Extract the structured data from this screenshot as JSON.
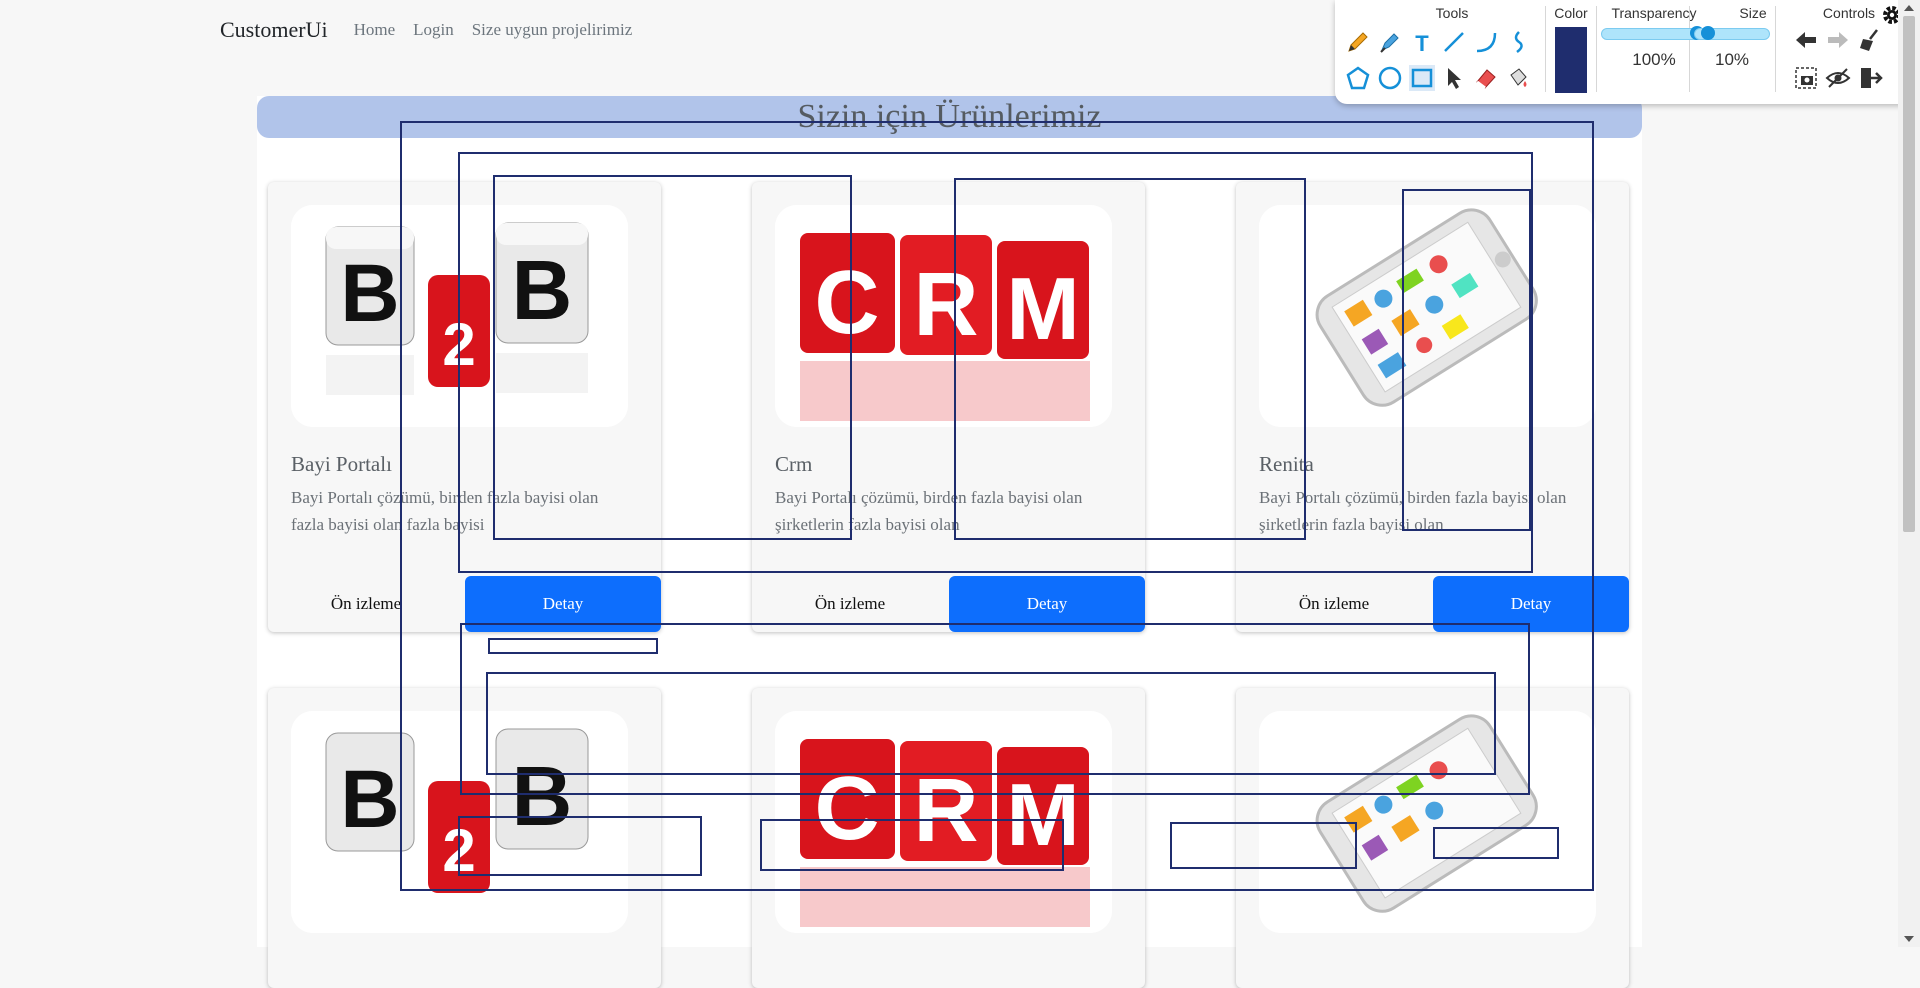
{
  "nav": {
    "brand": "CustomerUi",
    "links": [
      "Home",
      "Login",
      "Size uygun projelirimiz"
    ]
  },
  "page_title": "Sizin için Ürünlerimiz",
  "cards": [
    {
      "image": "b2b-dice-image",
      "title": "Bayi Portalı",
      "text": "Bayi Portalı çözümü, birden fazla bayisi olan fazla bayisi olan fazla bayisi",
      "preview": "Ön izleme",
      "detail": "Detay"
    },
    {
      "image": "crm-cubes-image",
      "title": "Crm",
      "text": "Bayi Portalı çözümü, birden fazla bayisi olan şirketlerin fazla bayisi olan",
      "preview": "Ön izleme",
      "detail": "Detay"
    },
    {
      "image": "smartphone-charts-image",
      "title": "Renita",
      "text": "Bayi Portalı çözümü, birden fazla bayisi olan şirketlerin fazla bayisi olan",
      "preview": "Ön izleme",
      "detail": "Detay"
    },
    {
      "image": "b2b-dice-image"
    },
    {
      "image": "crm-cubes-image"
    },
    {
      "image": "smartphone-charts-image"
    }
  ],
  "toolbar": {
    "headers": {
      "tools": "Tools",
      "color": "Color",
      "transparency": "Transparency",
      "size": "Size",
      "controls": "Controls"
    },
    "transparency_value": "100%",
    "transparency_level": 1.0,
    "size_value": "10%",
    "size_level": 0.1,
    "current_color": "#1f2d6e",
    "tools": [
      "pencil-icon",
      "marker-icon",
      "text-icon",
      "line-icon",
      "curve-icon",
      "freehand-icon",
      "polygon-icon",
      "circle-icon",
      "rectangle-icon",
      "select-arrow-icon",
      "eraser-icon",
      "fill-bucket-icon"
    ],
    "controls": [
      "undo-icon",
      "redo-icon",
      "clear-broom-icon",
      "screenshot-icon",
      "hide-eye-icon",
      "exit-icon"
    ],
    "settings_icon": "gear-icon"
  },
  "accent_color": "#0d6efd",
  "title_bar_color": "#b1c4ea"
}
